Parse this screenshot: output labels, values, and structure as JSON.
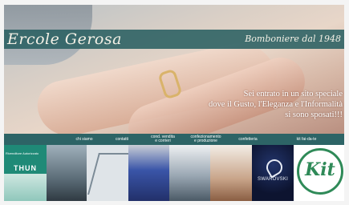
{
  "header": {
    "logo": "Ercole Gerosa",
    "tagline": "Bomboniere dal 1948"
  },
  "hero": {
    "message_lines": [
      "Sei entrato in un sito speciale",
      "dove il Gusto, l'Eleganza e l'Informalità",
      "si sono sposati!!!"
    ]
  },
  "nav": {
    "items": [
      {
        "label_lines": [
          "chi siamo"
        ]
      },
      {
        "label_lines": [
          "contatti"
        ]
      },
      {
        "label_lines": [
          "cond. vendita",
          "e corrieri"
        ]
      },
      {
        "label_lines": [
          "confezionamento",
          "e produzione"
        ]
      },
      {
        "label_lines": [
          "confetteria"
        ]
      },
      {
        "label_lines": [
          "kit fai-da-te"
        ]
      }
    ]
  },
  "thumbnails": {
    "thun_caption": "Rivenditore Autorizzato",
    "thun_brand": "THUN",
    "swarovski_brand": "SWAROVSKI",
    "kit_brand": "Kit"
  },
  "colors": {
    "banner": "#2a6062",
    "nav": "#2d6466",
    "thun": "#1f8a77",
    "kit": "#2f8a58"
  }
}
